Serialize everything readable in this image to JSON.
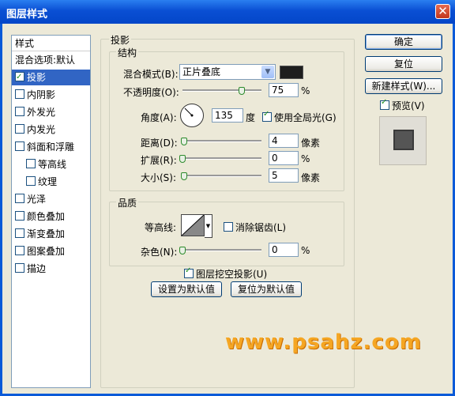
{
  "window": {
    "title": "图层样式",
    "close_glyph": "✕"
  },
  "left_panel": {
    "header": "样式",
    "items": [
      {
        "label": "混合选项:默认",
        "checkbox": false,
        "checked": false,
        "selected": false,
        "indent": false
      },
      {
        "label": "投影",
        "checkbox": true,
        "checked": true,
        "selected": true,
        "indent": false
      },
      {
        "label": "内阴影",
        "checkbox": true,
        "checked": false,
        "selected": false,
        "indent": false
      },
      {
        "label": "外发光",
        "checkbox": true,
        "checked": false,
        "selected": false,
        "indent": false
      },
      {
        "label": "内发光",
        "checkbox": true,
        "checked": false,
        "selected": false,
        "indent": false
      },
      {
        "label": "斜面和浮雕",
        "checkbox": true,
        "checked": false,
        "selected": false,
        "indent": false
      },
      {
        "label": "等高线",
        "checkbox": true,
        "checked": false,
        "selected": false,
        "indent": true
      },
      {
        "label": "纹理",
        "checkbox": true,
        "checked": false,
        "selected": false,
        "indent": true
      },
      {
        "label": "光泽",
        "checkbox": true,
        "checked": false,
        "selected": false,
        "indent": false
      },
      {
        "label": "颜色叠加",
        "checkbox": true,
        "checked": false,
        "selected": false,
        "indent": false
      },
      {
        "label": "渐变叠加",
        "checkbox": true,
        "checked": false,
        "selected": false,
        "indent": false
      },
      {
        "label": "图案叠加",
        "checkbox": true,
        "checked": false,
        "selected": false,
        "indent": false
      },
      {
        "label": "描边",
        "checkbox": true,
        "checked": false,
        "selected": false,
        "indent": false
      }
    ]
  },
  "drop_shadow": {
    "title": "投影",
    "structure": {
      "title": "结构",
      "blend_mode_label": "混合模式(B):",
      "blend_mode_value": "正片叠底",
      "shadow_color": "#1e1e1e",
      "opacity_label": "不透明度(O):",
      "opacity_value": "75",
      "opacity_unit": "%",
      "opacity_level": 0.75,
      "angle_label": "角度(A):",
      "angle_value": "135",
      "angle_unit": "度",
      "use_global_light_label": "使用全局光(G)",
      "use_global_light": true,
      "distance_label": "距离(D):",
      "distance_value": "4",
      "distance_unit": "像素",
      "distance_level": 0.02,
      "spread_label": "扩展(R):",
      "spread_value": "0",
      "spread_unit": "%",
      "spread_level": 0,
      "size_label": "大小(S):",
      "size_value": "5",
      "size_unit": "像素",
      "size_level": 0.02
    },
    "quality": {
      "title": "品质",
      "contour_label": "等高线:",
      "anti_aliased_label": "消除锯齿(L)",
      "anti_aliased": false,
      "noise_label": "杂色(N):",
      "noise_value": "0",
      "noise_unit": "%",
      "noise_level": 0
    },
    "knockout_label": "图层挖空投影(U)",
    "knockout": true,
    "set_default_label": "设置为默认值",
    "reset_default_label": "复位为默认值"
  },
  "buttons": {
    "ok": "确定",
    "reset": "复位",
    "new_style": "新建样式(W)...",
    "preview_label": "预览(V)",
    "preview_checked": true
  },
  "watermark": "www.psahz.com"
}
